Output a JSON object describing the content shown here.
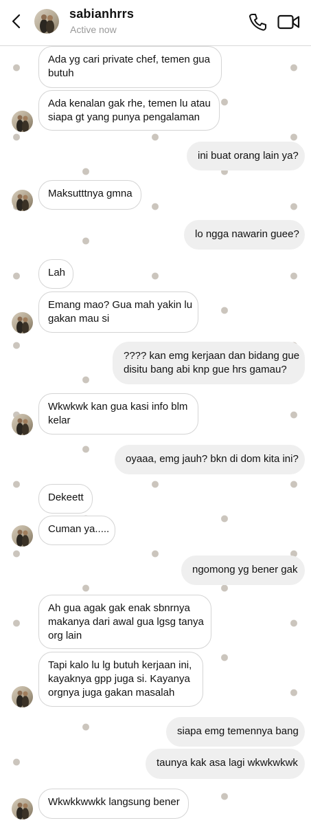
{
  "header": {
    "username": "sabianhrrs",
    "status": "Active now"
  },
  "messages": [
    {
      "side": "in",
      "text": "Ada yg cari private chef, temen gua\nbutuh"
    },
    {
      "side": "in",
      "text": "Ada kenalan gak rhe, temen lu atau\nsiapa gt yang punya pengalaman"
    },
    {
      "side": "out",
      "text": "ini buat orang lain ya?"
    },
    {
      "side": "in",
      "text": "Maksutttnya gmna"
    },
    {
      "side": "out",
      "text": "lo ngga nawarin guee?"
    },
    {
      "side": "in",
      "text": "Lah"
    },
    {
      "side": "in",
      "text": "Emang mao? Gua mah yakin lu\ngakan mau si"
    },
    {
      "side": "out",
      "text": "???? kan emg kerjaan dan bidang gue\ndisitu bang abi knp gue hrs gamau?"
    },
    {
      "side": "in",
      "text": "Wkwkwk kan gua kasi info blm\nkelar"
    },
    {
      "side": "out",
      "text": "oyaaa, emg jauh? bkn di dom kita ini?"
    },
    {
      "side": "in",
      "text": "Dekeett"
    },
    {
      "side": "in",
      "text": "Cuman ya....."
    },
    {
      "side": "out",
      "text": "ngomong yg bener gak"
    },
    {
      "side": "in",
      "text": "Ah gua agak gak enak sbnrnya\nmakanya dari awal gua lgsg tanya\norg lain"
    },
    {
      "side": "in",
      "text": "Tapi kalo lu lg butuh kerjaan ini,\nkayaknya gpp juga si. Kayanya\norgnya juga gakan masalah"
    },
    {
      "side": "out",
      "text": "siapa emg temennya bang"
    },
    {
      "side": "out",
      "text": "taunya kak asa lagi wkwkwkwk"
    },
    {
      "side": "in",
      "text": "Wkwkkwwkk langsung bener"
    }
  ]
}
